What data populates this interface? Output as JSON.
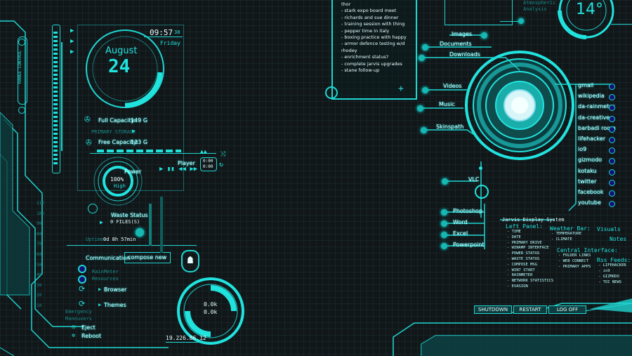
{
  "left": {
    "side_label": "RANGE CONTROL",
    "time": "09:57",
    "seconds": "38",
    "weekday": "Friday",
    "month": "August",
    "day": "24",
    "full_capacity_label": "Full Capacity:",
    "full_capacity_value": "149 G",
    "primary_storage": "PRIMARY STORAGE",
    "free_capacity_label": "Free Capacity:",
    "free_capacity_value": "133 G",
    "power_label": "Power",
    "power_value": "100%",
    "power_sub": "High",
    "player_label": "Player",
    "player_time1": "0:00",
    "player_time2": "0:00",
    "waste_label": "Waste Status",
    "waste_value": "0 FILES(S)",
    "uptime_label": "Uptime:",
    "uptime_value": "0d 8h 57min",
    "communication_label": "Communication",
    "compose_label": "compose new",
    "rainmeter_resources": "RainMeter\nResources",
    "browser_label": "Browser",
    "themes_label": "Themes",
    "emergency_label": "Emergency\nManeuvers",
    "eject_label": "Eject",
    "reboot_label": "Reboot",
    "net_up": "0.0k",
    "net_down": "0.0k",
    "ip": "19.226.86.12",
    "scale": [
      "110",
      "100",
      "90",
      "80",
      "70",
      "60",
      "50",
      "40",
      "30",
      "20",
      "10"
    ]
  },
  "notes": {
    "items": [
      "thor",
      "- stark expo board meet",
      "- richards and sue dinner",
      "- training session with thing",
      "- pepper time in italy",
      "- boxing practice with happy",
      "- armor defence testing w/d",
      "rhodey",
      "- enrichment status?",
      "- complete jarvis upgrades",
      "- stane follow-up"
    ],
    "add_button": "+"
  },
  "weather": {
    "caption": "Atmospheric\nAnalysis",
    "temperature": "14°"
  },
  "hub": {
    "left_links": [
      "Images",
      "Documents",
      "Downloads",
      "Videos",
      "Music",
      "Skinspath"
    ],
    "right_links": [
      "gmail",
      "wikipedia",
      "da-rainmeter",
      "da-creative",
      "barbadi room",
      "lifehacker",
      "io9",
      "gizmodo",
      "kotaku",
      "twitter",
      "facebook",
      "youtube"
    ],
    "vlc": "VLC",
    "office_links": [
      "Photoshop",
      "Word",
      "Excel",
      "Powerpoint"
    ]
  },
  "help": {
    "system_title": "Jarvis Display System",
    "left_panel_title": "Left Panel:",
    "left_panel_items": [
      "- TIME",
      "- DATE",
      "- PRIMARY DRIVE",
      "- WINAMP INTERFACE",
      "- POWER STATUS",
      "- WASTE STATUS",
      "- COMPOSE MSG",
      "- WIN7 START",
      "- RAINMETER",
      "- NETWORK STATISTICS",
      "- EVASION"
    ],
    "weather_title": "Weather Bar:",
    "weather_items": [
      "- TEMPERATURE",
      "- CLIMATE"
    ],
    "visuals_title": "Visuals",
    "notes_title": "Notes",
    "central_title": "Central Interface:",
    "central_items": [
      "- FOLDER LINKS",
      "- WEB CONNECT",
      "- PRIMARY APPS"
    ],
    "rss_title": "Rss Feeds:",
    "rss_items": [
      "- LIFEHACKER",
      "- io9",
      "- GIZMODO",
      "- TOI NEWS"
    ]
  },
  "footer_buttons": [
    "SHUTDOWN",
    "RESTART",
    "LOG OFF"
  ],
  "colors": {
    "accent": "#1fd6d2",
    "bg": "#111719",
    "glow": "#00ffff"
  }
}
